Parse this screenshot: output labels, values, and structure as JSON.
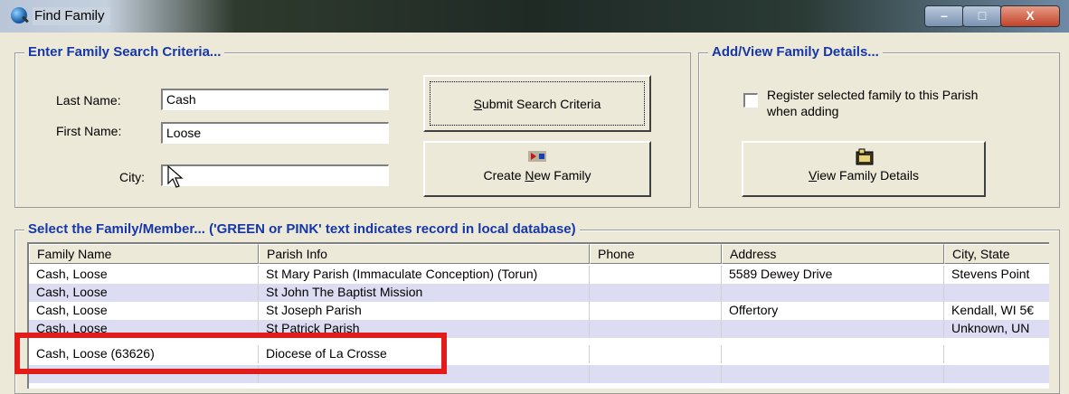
{
  "window": {
    "title": "Find Family",
    "controls": {
      "minimize": "–",
      "maximize": "□",
      "close": "X"
    }
  },
  "search": {
    "group_title": "Enter Family Search Criteria...",
    "last_name_label": "Last Name:",
    "last_name_value": "Cash",
    "first_name_label": "First Name:",
    "first_name_value": "Loose",
    "city_label": "City:",
    "city_value": "",
    "submit_label": "Submit Search Criteria",
    "create_label": "Create New Family"
  },
  "details": {
    "group_title": "Add/View Family Details...",
    "register_label_line1": "Register selected family to this Parish",
    "register_label_line2": "when adding",
    "register_checked": false,
    "view_label": "View Family Details"
  },
  "results": {
    "group_title": "Select the Family/Member...   ('GREEN or PINK' text indicates record in local database)",
    "columns": [
      "Family Name",
      "Parish Info",
      "Phone",
      "Address",
      "City, State"
    ],
    "rows": [
      [
        "Cash, Loose",
        "St Mary Parish (Immaculate Conception) (Torun)",
        "",
        "5589 Dewey Drive",
        "Stevens Point"
      ],
      [
        "Cash, Loose",
        "St John The Baptist Mission",
        "",
        "",
        ""
      ],
      [
        "Cash, Loose",
        "St Joseph Parish",
        "",
        "Offertory",
        "Kendall, WI 5€"
      ],
      [
        "Cash, Loose",
        "St Patrick Parish",
        "",
        "",
        "Unknown, UN"
      ],
      [
        "Cash, Loose (63626)",
        "Diocese of La Crosse",
        "",
        "",
        ""
      ],
      [
        "",
        "",
        "",
        "",
        ""
      ]
    ]
  },
  "colors": {
    "group_title": "#1637a8",
    "alt_row": "#dcdcf2",
    "highlight_border": "#e21b1b"
  },
  "icons": [
    "app-search-icon",
    "create-family-icon",
    "view-details-icon",
    "mouse-cursor-icon"
  ]
}
